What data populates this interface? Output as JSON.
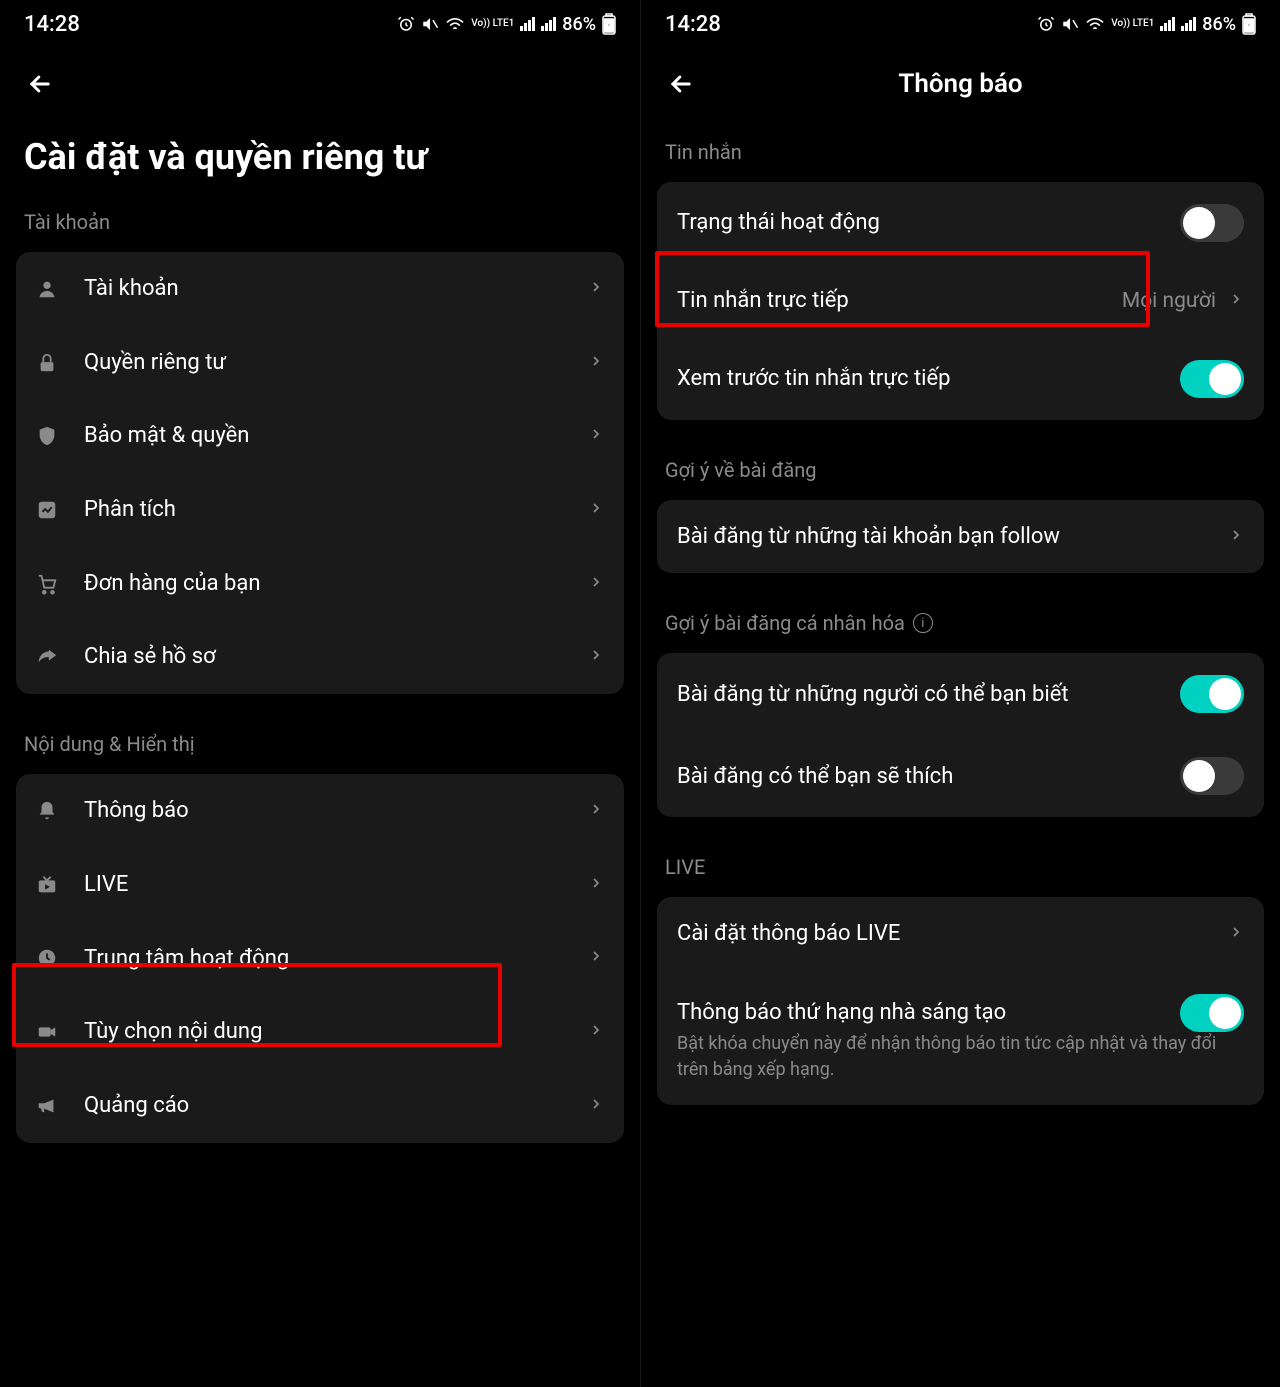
{
  "status": {
    "time": "14:28",
    "battery": "86%",
    "lte": "Vo)) LTE1"
  },
  "left": {
    "title": "Cài đặt và quyền riêng tư",
    "section_account": "Tài khoản",
    "section_content": "Nội dung & Hiển thị",
    "items_account": [
      {
        "label": "Tài khoản",
        "icon": "user"
      },
      {
        "label": "Quyền riêng tư",
        "icon": "lock"
      },
      {
        "label": "Bảo mật & quyền",
        "icon": "shield"
      },
      {
        "label": "Phân tích",
        "icon": "chart"
      },
      {
        "label": "Đơn hàng của bạn",
        "icon": "cart"
      },
      {
        "label": "Chia sẻ hồ sơ",
        "icon": "share"
      }
    ],
    "items_content": [
      {
        "label": "Thông báo",
        "icon": "bell"
      },
      {
        "label": "LIVE",
        "icon": "tv"
      },
      {
        "label": "Trung tâm hoạt động",
        "icon": "clock"
      },
      {
        "label": "Tùy chọn nội dung",
        "icon": "video"
      },
      {
        "label": "Quảng cáo",
        "icon": "megaphone"
      }
    ]
  },
  "right": {
    "header": "Thông báo",
    "section_msg": "Tin nhắn",
    "section_post": "Gợi ý về bài đăng",
    "section_personal": "Gợi ý bài đăng cá nhân hóa",
    "section_live": "LIVE",
    "activity": "Trạng thái hoạt động",
    "dm": "Tin nhắn trực tiếp",
    "dm_value": "Mọi người",
    "preview": "Xem trước tin nhắn trực tiếp",
    "follow_posts": "Bài đăng từ những tài khoản bạn follow",
    "may_know": "Bài đăng từ những người có thể bạn biết",
    "may_like": "Bài đăng có thể bạn sẽ thích",
    "live_settings": "Cài đặt thông báo LIVE",
    "creator_rank": "Thông báo thứ hạng nhà sáng tạo",
    "creator_rank_sub": "Bật khóa chuyển này để nhận thông báo tin tức cập nhật và thay đổi trên bảng xếp hạng."
  }
}
